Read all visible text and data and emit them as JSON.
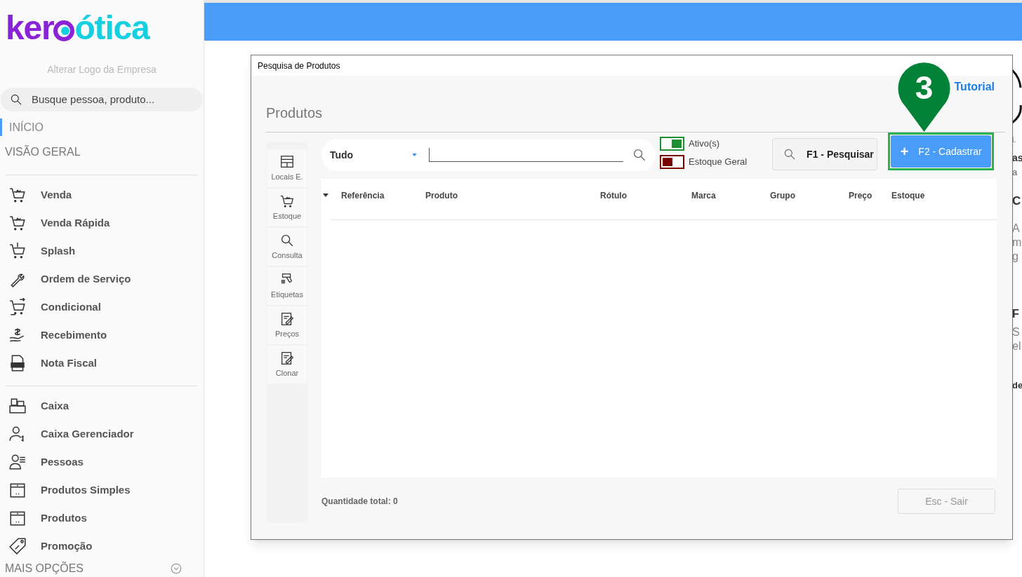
{
  "logo": {
    "left": "ker",
    "right": "ótica"
  },
  "sidebar": {
    "change_logo": "Alterar Logo da Empresa",
    "search": {
      "placeholder": "Busque pessoa, produto..."
    },
    "nav": [
      {
        "label": "INÍCIO",
        "selected": true
      },
      {
        "label": "VISÃO GERAL",
        "selected": false
      }
    ],
    "groups": [
      [
        {
          "label": "Venda"
        },
        {
          "label": "Venda Rápida"
        },
        {
          "label": "Splash"
        },
        {
          "label": "Ordem de Serviço"
        },
        {
          "label": "Condicional"
        },
        {
          "label": "Recebimento"
        },
        {
          "label": "Nota Fiscal"
        }
      ],
      [
        {
          "label": "Caixa"
        },
        {
          "label": "Caixa Gerenciador"
        },
        {
          "label": "Pessoas"
        },
        {
          "label": "Produtos Simples"
        },
        {
          "label": "Produtos"
        },
        {
          "label": "Promoção"
        }
      ]
    ],
    "more": "MAIS OPÇÕES"
  },
  "background_fragments": [
    "L",
    "as",
    "a",
    "C",
    "A",
    "m",
    "g",
    "F",
    "S",
    "el",
    "de"
  ],
  "dialog": {
    "title": "Pesquisa de Produtos",
    "heading": "Produtos",
    "tutorial": "Tutorial",
    "tools": [
      {
        "label": "Locais E."
      },
      {
        "label": "Estoque"
      },
      {
        "label": "Consulta"
      },
      {
        "label": "Etiquetas"
      },
      {
        "label": "Preços"
      },
      {
        "label": "Clonar"
      }
    ],
    "filter": {
      "value": "Tudo"
    },
    "toggles": [
      {
        "label": "Ativo(s)",
        "on": true
      },
      {
        "label": "Estoque Geral",
        "on": false
      }
    ],
    "search_button": "F1 - Pesquisar",
    "add_button": "F2 - Cadastrar",
    "add_plus": "+",
    "table": {
      "columns": [
        "Referência",
        "Produto",
        "Rótulo",
        "Marca",
        "Grupo",
        "Preço",
        "Estoque"
      ]
    },
    "total": "Quantidade total: 0",
    "exit_button": "Esc - Sair"
  },
  "step_marker": "3"
}
